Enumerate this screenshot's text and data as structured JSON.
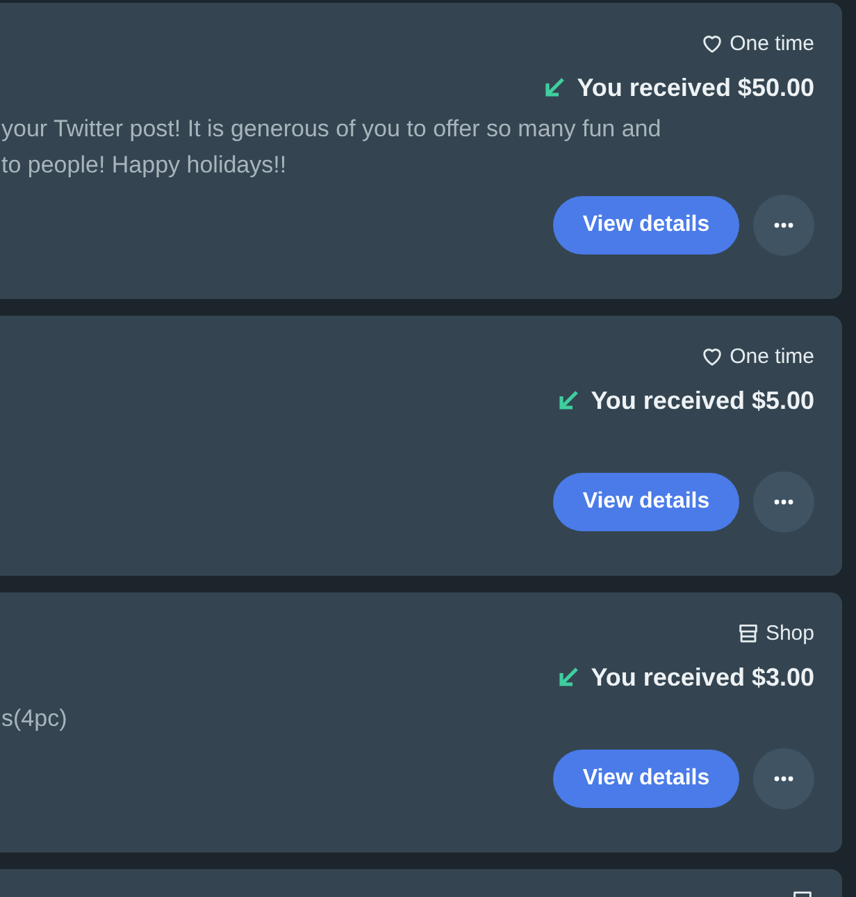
{
  "transactions": [
    {
      "tag": {
        "kind": "heart",
        "label": "One time"
      },
      "amount": "You received $50.00",
      "message_lines": [
        "your Twitter post! It is generous of you to offer so many fun and",
        "to people! Happy holidays!!"
      ],
      "button": "View details"
    },
    {
      "tag": {
        "kind": "heart",
        "label": "One time"
      },
      "amount": "You received $5.00",
      "button": "View details"
    },
    {
      "tag": {
        "kind": "shop",
        "label": "Shop"
      },
      "amount": "You received $3.00",
      "message_lines": [
        "s(4pc)"
      ],
      "button": "View details"
    },
    {
      "tag": {
        "kind": "shop"
      }
    }
  ]
}
